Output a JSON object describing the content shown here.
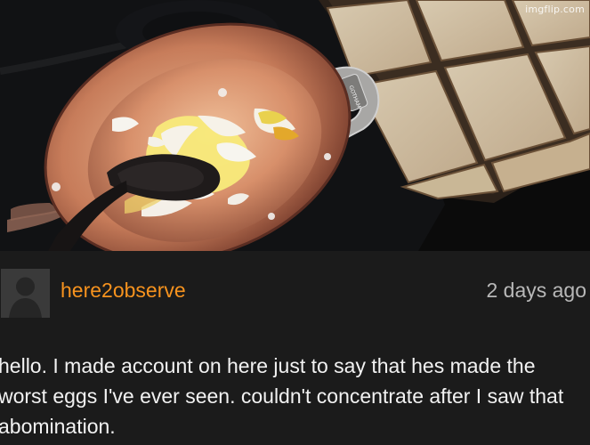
{
  "watermark": "imgflip.com",
  "comment": {
    "username": "here2observe",
    "timestamp": "2 days ago",
    "body": "hello. I made account on here just to say that hes made the worst eggs I've ever seen. couldn't concentrate after I saw that abomination."
  },
  "icons": {
    "avatar": "default-user-avatar-icon"
  },
  "colors": {
    "username": "#f7931e",
    "timestamp": "#b8b8b8",
    "comment_bg": "#1b1b1b",
    "text": "#f2f2f2"
  }
}
